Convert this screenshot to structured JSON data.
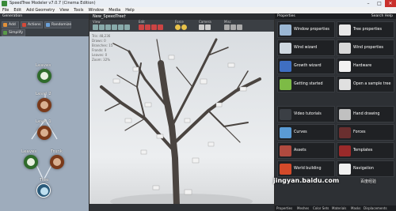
{
  "titlebar": {
    "title": "SpeedTree Modeler v7.0.7 (Cinema Edition)",
    "min": "–",
    "max": "□",
    "close": "✕"
  },
  "menu": [
    "File",
    "Edit",
    "Add Geometry",
    "View",
    "Tools",
    "Window",
    "Media",
    "Help"
  ],
  "left": {
    "header": "Generation",
    "buttons": {
      "add": "Add",
      "actions": "Actions",
      "randomize": "Randomize",
      "simplify": "Simplify"
    },
    "nodes": {
      "leaves_top": "Leaves",
      "level2": "Level 2",
      "level1": "Level 1",
      "leaves_left": "Leaves",
      "trunk": "Trunk",
      "tree": "Tree"
    }
  },
  "viewport": {
    "tab": "New_SpeedTree†",
    "groups": [
      "View",
      "Edit",
      "Force",
      "Camera",
      "Misc"
    ],
    "stats": [
      "Tris: 48,236",
      "Draws: 0",
      "Branches: 15",
      "Fronds: 0",
      "Leaves: 0",
      "Zoom: 32%"
    ]
  },
  "right": {
    "header": "Properties",
    "search": "Search Help",
    "cards": [
      {
        "label": "Window properties",
        "color": "#9bb7d4",
        "icon": "window-icon"
      },
      {
        "label": "Tree properties",
        "color": "#e8e8e8",
        "icon": "tree-icon"
      },
      {
        "label": "Wind wizard",
        "color": "#cfd8e0",
        "icon": "wind-icon"
      },
      {
        "label": "Wind properties",
        "color": "#d8d8d8",
        "icon": "wind-prop-icon"
      },
      {
        "label": "Growth wizard",
        "color": "#3f6fc2",
        "icon": "growth-icon"
      },
      {
        "label": "Hardware",
        "color": "#f2f2f2",
        "icon": "hardware-icon"
      },
      {
        "label": "Getting started",
        "color": "#7dbb46",
        "icon": "start-icon"
      },
      {
        "label": "Open a sample tree",
        "color": "#e0e0e0",
        "icon": "sample-icon"
      },
      {
        "label": "Video tutorials",
        "color": "#3b3f45",
        "icon": "video-icon"
      },
      {
        "label": "Hand drawing",
        "color": "#c0c0c0",
        "icon": "hand-icon"
      },
      {
        "label": "Curves",
        "color": "#5a9bd5",
        "icon": "curve-icon"
      },
      {
        "label": "Forces",
        "color": "#6a2f2f",
        "icon": "force-icon"
      },
      {
        "label": "Assets",
        "color": "#b04a3f",
        "icon": "assets-icon"
      },
      {
        "label": "Templates",
        "color": "#9a2a2a",
        "icon": "template-icon"
      },
      {
        "label": "World building",
        "color": "#d44a2a",
        "icon": "world-icon"
      },
      {
        "label": "Navigation",
        "color": "#f1f1f1",
        "icon": "nav-icon"
      }
    ],
    "tabs": [
      "Properties",
      "Meshes",
      "Color Sets",
      "Materials",
      "Masks",
      "Displacements"
    ]
  },
  "watermark": "jingyan.baidu.com",
  "watermark_site": "百度经验"
}
